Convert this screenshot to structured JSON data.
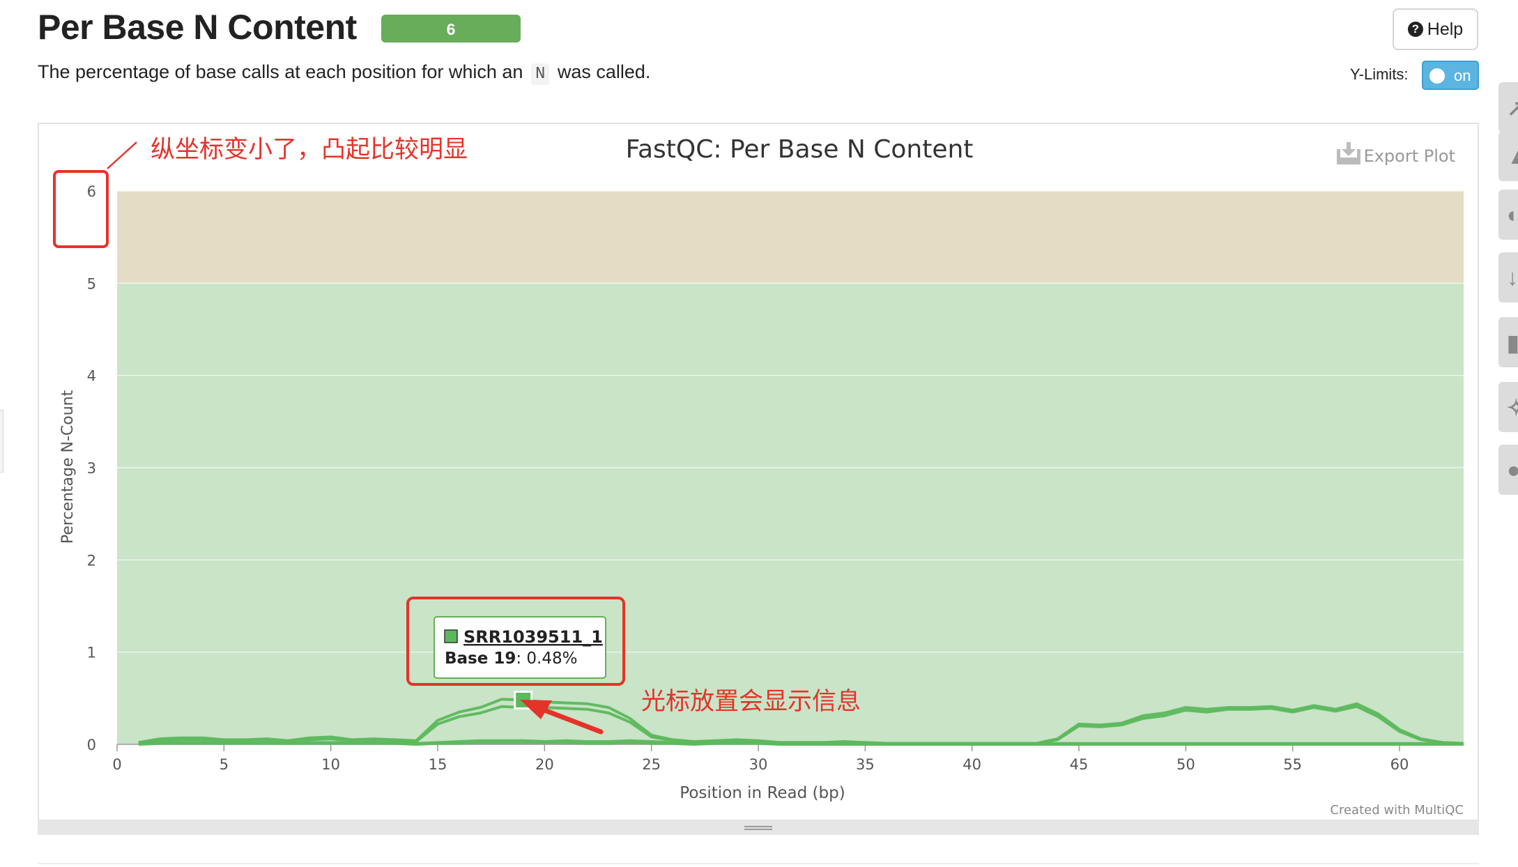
{
  "header": {
    "title": "Per Base N Content",
    "badge": "6",
    "help_label": "Help",
    "description_before": "The percentage of base calls at each position for which an",
    "description_code": "N",
    "description_after": "was called."
  },
  "ylimits": {
    "label": "Y-Limits:",
    "state": "on"
  },
  "plot": {
    "export_label": "Export Plot",
    "credit": "Created with MultiQC"
  },
  "annotations": {
    "note_axis": "纵坐标变小了，凸起比较明显",
    "note_cursor": "光标放置会显示信息",
    "box_color": "#e5332a"
  },
  "tooltip": {
    "sample": "SRR1039511_1",
    "base_label": "Base 19",
    "value_text": ": 0.48%"
  },
  "colors": {
    "warn_band": "#e5dcc6",
    "ok_band": "#c9e4c7",
    "series": "#5cb85c"
  },
  "chart_data": {
    "type": "line",
    "title": "FastQC: Per Base N Content",
    "xlabel": "Position in Read (bp)",
    "ylabel": "Percentage N-Count",
    "xlim": [
      0,
      63
    ],
    "ylim": [
      0,
      6
    ],
    "xticks": [
      0,
      5,
      10,
      15,
      20,
      25,
      30,
      35,
      40,
      45,
      50,
      55,
      60
    ],
    "yticks": [
      0,
      1,
      2,
      3,
      4,
      5,
      6
    ],
    "grid": true,
    "bands": [
      {
        "from": 0,
        "to": 5,
        "status": "pass"
      },
      {
        "from": 5,
        "to": 6,
        "status": "warn"
      }
    ],
    "x": [
      1,
      2,
      3,
      4,
      5,
      6,
      7,
      8,
      9,
      10,
      11,
      12,
      13,
      14,
      15,
      16,
      17,
      18,
      19,
      20,
      21,
      22,
      23,
      24,
      25,
      26,
      27,
      28,
      29,
      30,
      31,
      32,
      33,
      34,
      35,
      36,
      37,
      38,
      39,
      40,
      41,
      42,
      43,
      44,
      45,
      46,
      47,
      48,
      49,
      50,
      51,
      52,
      53,
      54,
      55,
      56,
      57,
      58,
      59,
      60,
      61,
      62,
      63
    ],
    "series": [
      {
        "name": "SRR1039511_1",
        "values": [
          0.02,
          0.06,
          0.07,
          0.07,
          0.05,
          0.05,
          0.06,
          0.04,
          0.07,
          0.08,
          0.05,
          0.06,
          0.05,
          0.04,
          0.26,
          0.35,
          0.4,
          0.49,
          0.48,
          0.46,
          0.45,
          0.44,
          0.4,
          0.28,
          0.1,
          0.05,
          0.03,
          0.04,
          0.05,
          0.04,
          0.02,
          0.02,
          0.02,
          0.03,
          0.02,
          0.01,
          0.01,
          0.01,
          0.01,
          0.01,
          0.01,
          0.01,
          0.01,
          0.06,
          0.22,
          0.21,
          0.23,
          0.31,
          0.34,
          0.4,
          0.38,
          0.4,
          0.4,
          0.41,
          0.37,
          0.42,
          0.38,
          0.44,
          0.33,
          0.16,
          0.06,
          0.02,
          0.01
        ]
      },
      {
        "name": "",
        "values": [
          0.02,
          0.04,
          0.05,
          0.05,
          0.04,
          0.04,
          0.04,
          0.03,
          0.05,
          0.06,
          0.04,
          0.04,
          0.04,
          0.03,
          0.22,
          0.3,
          0.34,
          0.41,
          0.4,
          0.4,
          0.39,
          0.38,
          0.34,
          0.24,
          0.08,
          0.04,
          0.02,
          0.03,
          0.04,
          0.03,
          0.02,
          0.02,
          0.02,
          0.02,
          0.02,
          0.01,
          0.01,
          0.01,
          0.01,
          0.01,
          0.01,
          0.01,
          0.01,
          0.05,
          0.2,
          0.19,
          0.21,
          0.28,
          0.31,
          0.37,
          0.35,
          0.38,
          0.38,
          0.39,
          0.35,
          0.4,
          0.36,
          0.41,
          0.3,
          0.14,
          0.05,
          0.02,
          0.01
        ]
      },
      {
        "name": "",
        "values": [
          0.01,
          0.02,
          0.02,
          0.02,
          0.02,
          0.02,
          0.02,
          0.01,
          0.02,
          0.02,
          0.02,
          0.02,
          0.02,
          0.01,
          0.02,
          0.03,
          0.04,
          0.04,
          0.04,
          0.03,
          0.04,
          0.03,
          0.03,
          0.04,
          0.03,
          0.02,
          0.01,
          0.02,
          0.02,
          0.02,
          0.01,
          0.01,
          0.01,
          0.01,
          0.01,
          0.01,
          0.01,
          0.01,
          0.01,
          0.01,
          0.01,
          0.01,
          0.01,
          0.01,
          0.01,
          0.01,
          0.01,
          0.01,
          0.01,
          0.01,
          0.01,
          0.01,
          0.01,
          0.01,
          0.01,
          0.01,
          0.01,
          0.01,
          0.01,
          0.01,
          0.01,
          0.01,
          0.01
        ]
      },
      {
        "name": "",
        "values": [
          0.0,
          0.01,
          0.01,
          0.01,
          0.01,
          0.01,
          0.01,
          0.01,
          0.01,
          0.01,
          0.01,
          0.01,
          0.01,
          0.0,
          0.01,
          0.01,
          0.02,
          0.02,
          0.02,
          0.02,
          0.02,
          0.01,
          0.01,
          0.02,
          0.01,
          0.01,
          0.0,
          0.01,
          0.01,
          0.01,
          0.0,
          0.0,
          0.0,
          0.0,
          0.0,
          0.0,
          0.0,
          0.0,
          0.0,
          0.0,
          0.0,
          0.0,
          0.0,
          0.0,
          0.0,
          0.0,
          0.0,
          0.0,
          0.0,
          0.0,
          0.0,
          0.0,
          0.0,
          0.0,
          0.0,
          0.0,
          0.0,
          0.0,
          0.0,
          0.0,
          0.0,
          0.0,
          0.0
        ]
      }
    ],
    "highlight": {
      "series": "SRR1039511_1",
      "x": 19,
      "y": 0.48
    }
  }
}
